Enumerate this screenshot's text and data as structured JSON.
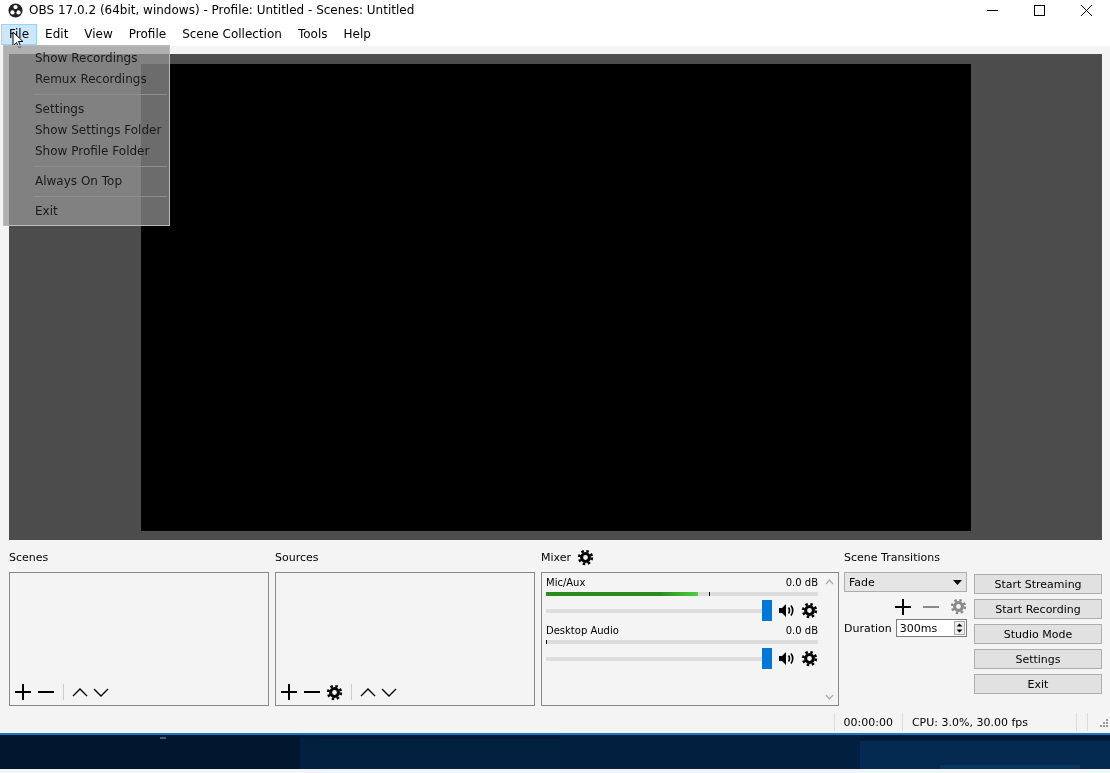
{
  "window": {
    "title": "OBS 17.0.2 (64bit, windows) - Profile: Untitled - Scenes: Untitled"
  },
  "menu": [
    {
      "label": "File",
      "selected": true
    },
    {
      "label": "Edit",
      "selected": false
    },
    {
      "label": "View",
      "selected": false
    },
    {
      "label": "Profile",
      "selected": false
    },
    {
      "label": "Scene Collection",
      "selected": false
    },
    {
      "label": "Tools",
      "selected": false
    },
    {
      "label": "Help",
      "selected": false
    }
  ],
  "file_menu": [
    {
      "kind": "item",
      "label": "Show Recordings"
    },
    {
      "kind": "item",
      "label": "Remux Recordings"
    },
    {
      "kind": "separator"
    },
    {
      "kind": "item",
      "label": "Settings"
    },
    {
      "kind": "item",
      "label": "Show Settings Folder"
    },
    {
      "kind": "item",
      "label": "Show Profile Folder"
    },
    {
      "kind": "separator"
    },
    {
      "kind": "item",
      "label": "Always On Top"
    },
    {
      "kind": "separator"
    },
    {
      "kind": "item",
      "label": "Exit"
    }
  ],
  "scenes": {
    "title": "Scenes",
    "tools": [
      {
        "kind": "add"
      },
      {
        "kind": "remove"
      },
      {
        "kind": "separator"
      },
      {
        "kind": "up"
      },
      {
        "kind": "down"
      }
    ]
  },
  "sources": {
    "title": "Sources",
    "tools": [
      {
        "kind": "add"
      },
      {
        "kind": "remove"
      },
      {
        "kind": "properties"
      },
      {
        "kind": "separator"
      },
      {
        "kind": "up"
      },
      {
        "kind": "down"
      }
    ]
  },
  "mixer": {
    "title": "Mixer",
    "channels": [
      {
        "name": "Mic/Aux",
        "reading": "0.0 dB",
        "meter": {
          "level": 0.56
        },
        "volume": {
          "level": 1.0
        }
      },
      {
        "name": "Desktop Audio",
        "reading": "0.0 dB",
        "meter": {
          "level": 0.0
        },
        "volume": {
          "level": 1.0
        }
      }
    ]
  },
  "scene_transitions": {
    "title": "Scene Transitions",
    "transition": "Fade",
    "tools": [
      {
        "kind": "add",
        "disabled": false
      },
      {
        "kind": "remove",
        "disabled": true
      },
      {
        "kind": "properties",
        "disabled": true
      }
    ],
    "duration_label": "Duration",
    "duration": "300ms"
  },
  "controls": [
    "Start Streaming",
    "Start Recording",
    "Studio Mode",
    "Settings",
    "Exit"
  ],
  "status_bar": {
    "time": "00:00:00",
    "cpu": "CPU: 3.0%, 30.00 fps"
  }
}
